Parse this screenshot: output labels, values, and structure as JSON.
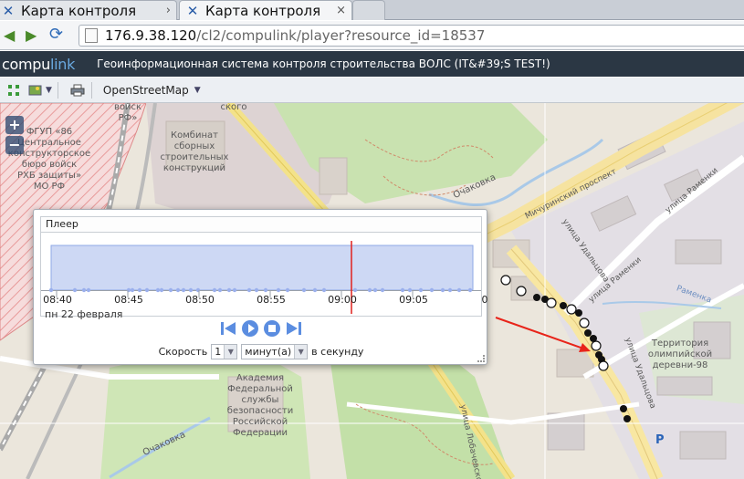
{
  "browser": {
    "tabs": [
      {
        "title": "Карта контроля",
        "active": false
      },
      {
        "title": "Карта контроля",
        "active": true
      }
    ],
    "tab_more": "›",
    "tab_close": "×",
    "url_host": "176.9.38.120",
    "url_path": "/cl2/compulink/player?resource_id=18537"
  },
  "app": {
    "logo_part1": "compu",
    "logo_part2": "link",
    "title": "Геоинформационная система контроля строительства ВОЛС (IT&#39;S TEST!)"
  },
  "toolbar": {
    "layer_label": "OpenStreetMap",
    "icons": [
      "extent-icon",
      "layers-icon",
      "print-icon"
    ]
  },
  "map": {
    "zoom_in": "+",
    "zoom_out": "−",
    "labels": {
      "fgup": "ФГУП «86\nЦентральное\nконструкторское\nбюро войск\nРХБ защиты»\nМО РФ",
      "fgup_rf": "войск\nРФ»",
      "kombinat": "Комбинат\nсборных\nстроительных\nконструкций",
      "academy": "Академия\nФедеральной\nслужбы\nбезопасности\nРоссийской\nФедерации",
      "territory": "Территория\nолимпийской\nдеревни-98",
      "ochakovka": "Очаковка",
      "ochakovka2": "Очаковка",
      "michurinsky": "Мичуринский проспект",
      "udaltsova": "улица Удальцова",
      "udaltsova2": "улица Удальцова",
      "ramenki": "улица Раменки",
      "ramenki2": "улица Раменки",
      "ramenka": "Раменка",
      "street_top": "ского",
      "street_lobach": "улица Лобачевского",
      "parking": "P"
    },
    "colors": {
      "route_black": "#111111",
      "route_white": "#ffffff",
      "arrow": "#e8241a"
    }
  },
  "player": {
    "title": "Плеер",
    "ticks": [
      "08:40",
      "08:45",
      "08:50",
      "08:55",
      "09:00",
      "09:05",
      "0"
    ],
    "date": "пн 22 февраля",
    "cursor_time": "09:00",
    "colors": {
      "area": "#cdd8f4",
      "area_border": "#8ea8e6",
      "cursor": "#e0201c",
      "event": "#9bb0ec"
    },
    "speed_label": "Скорость",
    "speed_value": "1",
    "speed_unit": "минут(а)",
    "speed_suffix": "в секунду",
    "controls": [
      "skip-start-icon",
      "play-icon",
      "stop-icon",
      "skip-end-icon"
    ]
  }
}
